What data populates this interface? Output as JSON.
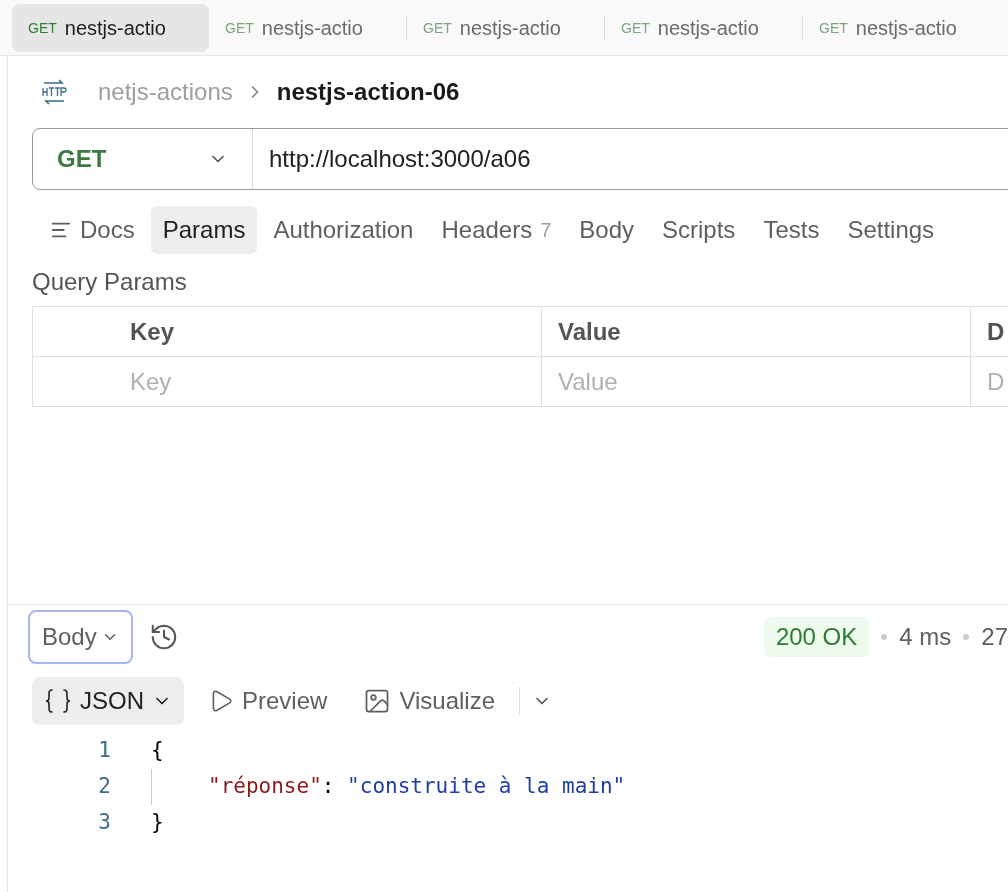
{
  "request_tabs": [
    {
      "method": "GET",
      "name": "nestjs-actio",
      "selected": true
    },
    {
      "method": "GET",
      "name": "nestjs-actio",
      "selected": false
    },
    {
      "method": "GET",
      "name": "nestjs-actio",
      "selected": false
    },
    {
      "method": "GET",
      "name": "nestjs-actio",
      "selected": false
    },
    {
      "method": "GET",
      "name": "nestjs-actio",
      "selected": false
    }
  ],
  "breadcrumb": {
    "collection": "netjs-actions",
    "request": "nestjs-action-06"
  },
  "url_bar": {
    "method": "GET",
    "url": "http://localhost:3000/a06"
  },
  "request_sections": [
    {
      "label": "Docs",
      "kind": "docs",
      "selected": false
    },
    {
      "label": "Params",
      "kind": "tab",
      "selected": true
    },
    {
      "label": "Authorization",
      "kind": "tab",
      "selected": false
    },
    {
      "label": "Headers",
      "kind": "tab",
      "count": "7",
      "selected": false
    },
    {
      "label": "Body",
      "kind": "tab",
      "selected": false
    },
    {
      "label": "Scripts",
      "kind": "tab",
      "selected": false
    },
    {
      "label": "Tests",
      "kind": "tab",
      "selected": false
    },
    {
      "label": "Settings",
      "kind": "tab",
      "selected": false
    }
  ],
  "query_params": {
    "title": "Query Params",
    "columns": [
      "Key",
      "Value",
      "D"
    ],
    "placeholders": [
      "Key",
      "Value",
      "D"
    ]
  },
  "response": {
    "view": "Body",
    "status": "200 OK",
    "time": "4 ms",
    "size": "27",
    "formats": [
      {
        "label": "JSON",
        "kind": "json",
        "selected": true
      },
      {
        "label": "Preview",
        "kind": "preview",
        "selected": false
      },
      {
        "label": "Visualize",
        "kind": "visualize",
        "selected": false
      }
    ],
    "code_lines": [
      {
        "number": "1",
        "tokens": [
          {
            "kind": "punct",
            "text": "{"
          }
        ]
      },
      {
        "number": "2",
        "indent": true,
        "tokens": [
          {
            "kind": "key",
            "text": "\"réponse\""
          },
          {
            "kind": "punct",
            "text": ": "
          },
          {
            "kind": "string",
            "text": "\"construite à la main\""
          }
        ]
      },
      {
        "number": "3",
        "tokens": [
          {
            "kind": "punct",
            "text": "}"
          }
        ]
      }
    ]
  }
}
